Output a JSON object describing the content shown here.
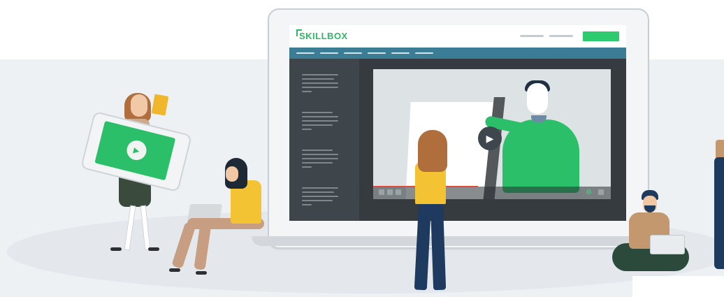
{
  "brand": {
    "logo_text": "SKILLBOX",
    "accent_color": "#2dcb6e",
    "menubar_color": "#3c7d96"
  },
  "video_player": {
    "play_icon": "play-icon",
    "progress": 0.44
  },
  "phone": {
    "play_icon": "play-icon"
  }
}
